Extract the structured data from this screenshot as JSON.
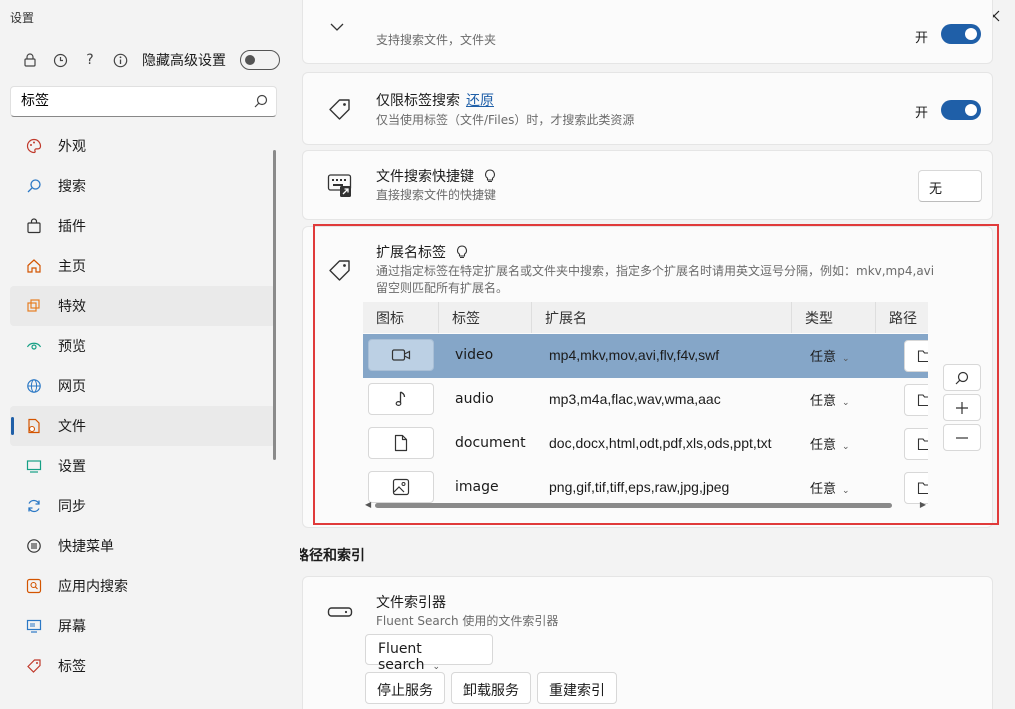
{
  "window": {
    "title": "设置"
  },
  "sidebar": {
    "advanced_label": "隐藏高级设置",
    "search": {
      "value": "标签",
      "placeholder": ""
    },
    "items": [
      {
        "label": "外观",
        "icon": "palette-icon"
      },
      {
        "label": "搜索",
        "icon": "search-icon"
      },
      {
        "label": "插件",
        "icon": "bag-icon"
      },
      {
        "label": "主页",
        "icon": "home-icon"
      },
      {
        "label": "特效",
        "icon": "layers-icon"
      },
      {
        "label": "预览",
        "icon": "eye-icon"
      },
      {
        "label": "网页",
        "icon": "globe-icon"
      },
      {
        "label": "文件",
        "icon": "file-icon"
      },
      {
        "label": "设置",
        "icon": "monitor-icon"
      },
      {
        "label": "同步",
        "icon": "sync-icon"
      },
      {
        "label": "快捷菜单",
        "icon": "menu-icon"
      },
      {
        "label": "应用内搜索",
        "icon": "app-search-icon"
      },
      {
        "label": "屏幕",
        "icon": "screen-icon"
      },
      {
        "label": "标签",
        "icon": "tag-icon"
      }
    ],
    "active_index": 7
  },
  "cards": {
    "files_sub": "支持搜索文件，文件夹",
    "files_toggle_label": "开",
    "tag_only": {
      "title": "仅限标签搜索",
      "restore": "还原",
      "sub": "仅当使用标签（文件/Files）时，才搜索此类资源",
      "toggle_label": "开"
    },
    "hotkey": {
      "title": "文件搜索快捷键",
      "sub": "直接搜索文件的快捷键",
      "value": "无"
    },
    "ext_tags": {
      "title": "扩展名标签",
      "desc": "通过指定标签在特定扩展名或文件夹中搜索，指定多个扩展名时请用英文逗号分隔，例如：mkv,mp4,avi",
      "desc2": "留空则匹配所有扩展名。",
      "columns": [
        "图标",
        "标签",
        "扩展名",
        "类型",
        "路径"
      ],
      "rows": [
        {
          "icon": "video-icon",
          "tag": "video",
          "ext": "mp4,mkv,mov,avi,flv,f4v,swf",
          "type": "任意"
        },
        {
          "icon": "music-note-icon",
          "tag": "audio",
          "ext": "mp3,m4a,flac,wav,wma,aac",
          "type": "任意"
        },
        {
          "icon": "document-icon",
          "tag": "document",
          "ext": "doc,docx,html,odt,pdf,xls,ods,ppt,txt",
          "type": "任意"
        },
        {
          "icon": "image-icon",
          "tag": "image",
          "ext": "png,gif,tif,tiff,eps,raw,jpg,jpeg",
          "type": "任意"
        }
      ],
      "selected_row": 0
    }
  },
  "indexing": {
    "section_title": "路径和索引",
    "indexer_title": "文件索引器",
    "indexer_sub": "Fluent Search 使用的文件索引器",
    "indexer_value": "Fluent search",
    "buttons": {
      "stop": "停止服务",
      "uninstall": "卸载服务",
      "rebuild": "重建索引"
    }
  },
  "colors": {
    "accent": "#1f5fa8",
    "selected_row": "#85a6c8",
    "highlight_border": "#e03a3a"
  }
}
